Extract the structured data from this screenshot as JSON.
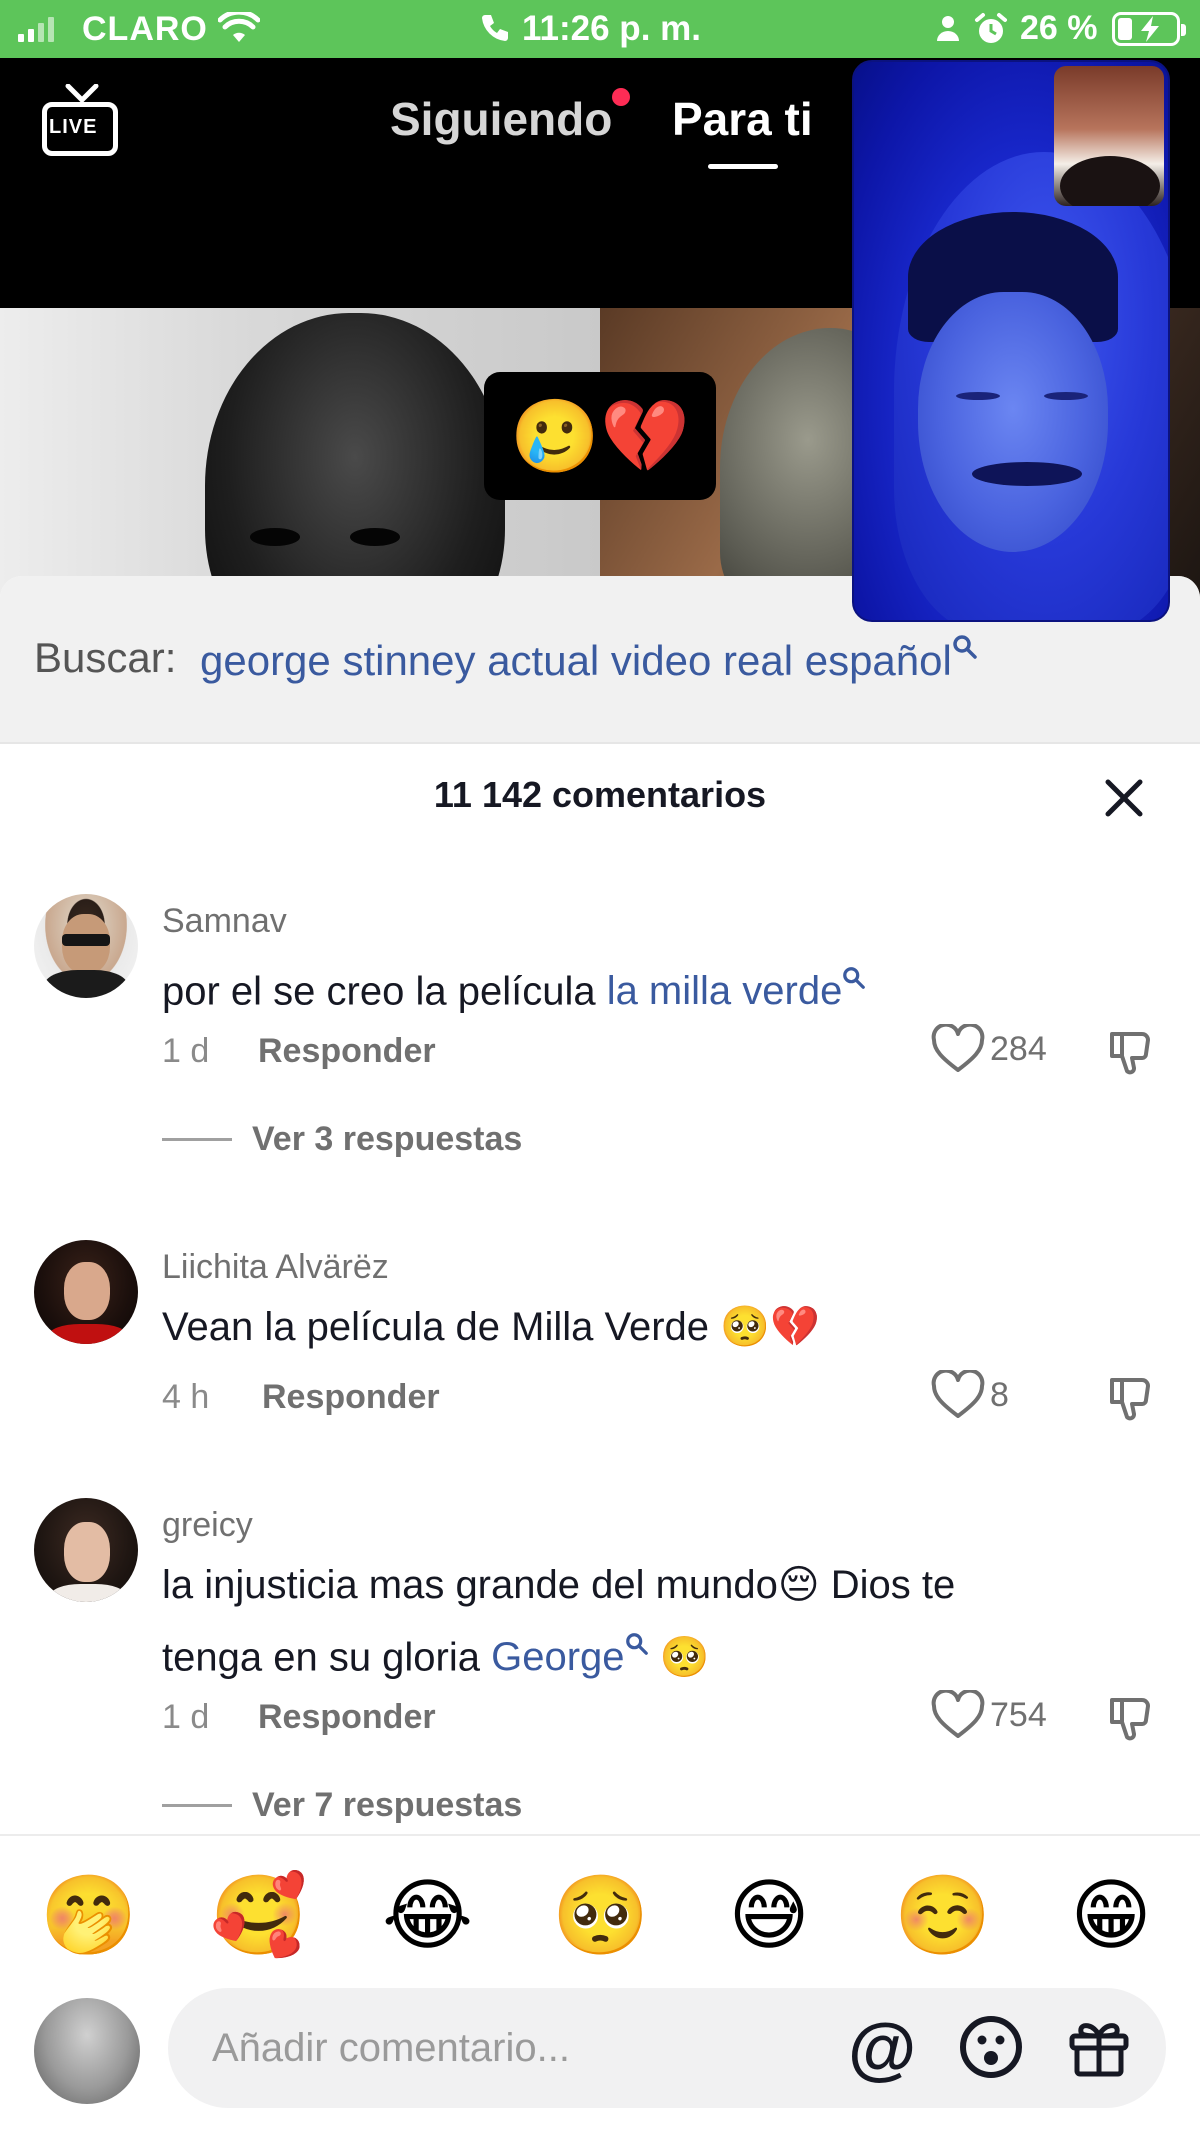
{
  "status_bar": {
    "carrier": "CLARO",
    "time": "11:26 p. m.",
    "battery_percent": "26 %",
    "icons": [
      "signal-icon",
      "wifi-icon",
      "phone-call-icon",
      "person-icon",
      "alarm-icon",
      "battery-charging-icon"
    ]
  },
  "nav": {
    "live_label": "LIVE",
    "tab_following": "Siguiendo",
    "tab_for_you": "Para ti",
    "active_tab": "Para ti"
  },
  "video": {
    "caption_emojis": "🥲💔"
  },
  "search": {
    "label": "Buscar:",
    "query": "george stinney actual video real español"
  },
  "comments_header": {
    "count": "11 142 comentarios"
  },
  "comments": [
    {
      "user": "Samnav",
      "text_before": "por el se creo la película ",
      "text_link": "la milla verde",
      "text_after": "",
      "time": "1 d",
      "reply_label": "Responder",
      "likes": "284",
      "replies_label": "Ver 3 respuestas"
    },
    {
      "user": "Liichita Alvärëz",
      "text_before": "Vean la película de Milla Verde 🥺💔",
      "time": "4 h",
      "reply_label": "Responder",
      "likes": "8"
    },
    {
      "user": "greicy",
      "text_line1": "la injusticia mas grande del mundo😔 Dios te",
      "text_line2_before": "tenga en su gloria ",
      "text_link": "George",
      "text_after": " 🥺",
      "time": "1 d",
      "reply_label": "Responder",
      "likes": "754",
      "replies_label": "Ver 7 respuestas"
    }
  ],
  "emoji_bar": [
    "🤭",
    "🥰",
    "😂",
    "🥺",
    "😅",
    "☺️",
    "😁"
  ],
  "composer": {
    "placeholder": "Añadir comentario...",
    "at_label": "@"
  },
  "colors": {
    "status_bar_bg": "#5dc55a",
    "link_blue": "#3a5a9f",
    "notification_dot": "#fe2c55"
  }
}
